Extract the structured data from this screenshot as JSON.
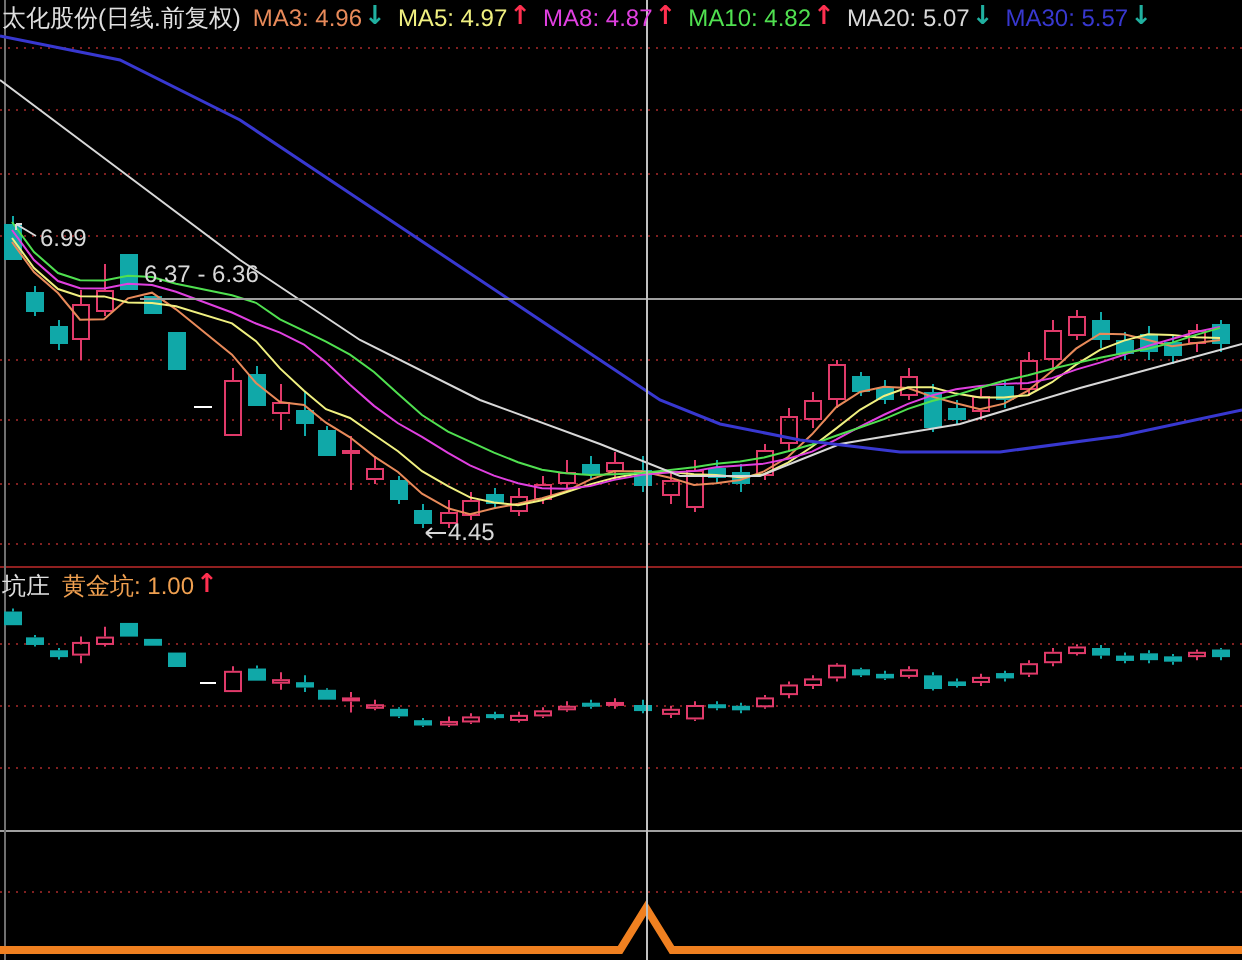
{
  "main_panel": {
    "title": "太化股份(日线.前复权)",
    "indicators": [
      {
        "label": "MA3: 4.96",
        "color": "#e88a5a",
        "arrow": {
          "symbol": "↓",
          "color": "#20b0a0"
        }
      },
      {
        "label": "MA5: 4.97",
        "color": "#f0f080",
        "arrow": {
          "symbol": "↑",
          "color": "#ff3050"
        }
      },
      {
        "label": "MA8: 4.87",
        "color": "#e040e0",
        "arrow": {
          "symbol": "↑",
          "color": "#ff3050"
        }
      },
      {
        "label": "MA10: 4.82",
        "color": "#50e050",
        "arrow": {
          "symbol": "↑",
          "color": "#ff3050"
        }
      },
      {
        "label": "MA20: 5.07",
        "color": "#d8d8d8",
        "arrow": {
          "symbol": "↓",
          "color": "#20b0a0"
        }
      },
      {
        "label": "MA30: 5.57",
        "color": "#3838d0",
        "arrow": {
          "symbol": "↓",
          "color": "#20b0a0"
        }
      }
    ],
    "price_labels": [
      {
        "kind": "high",
        "text": "6.99"
      },
      {
        "kind": "range",
        "text": "6.37 - 6.36"
      },
      {
        "kind": "low",
        "text": "4.45"
      }
    ]
  },
  "lower_panel": {
    "title": "坑庄",
    "indicators": [
      {
        "label": "黄金坑: 1.00",
        "color": "#f0a050",
        "arrow": {
          "symbol": "↑",
          "color": "#ff3050"
        }
      }
    ]
  }
}
